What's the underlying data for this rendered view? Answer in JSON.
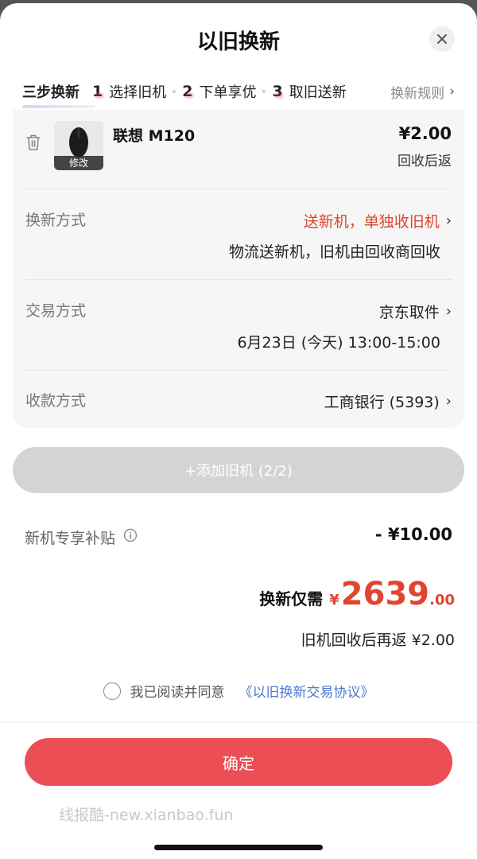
{
  "sheet": {
    "title": "以旧换新"
  },
  "steps": {
    "lead": "三步换新",
    "items": [
      {
        "num": "1",
        "label": "选择旧机"
      },
      {
        "num": "2",
        "label": "下单享优"
      },
      {
        "num": "3",
        "label": "取旧送新"
      }
    ],
    "rules_label": "换新规则"
  },
  "product": {
    "name": "联想 M120",
    "edit_label": "修改",
    "price": "¥2.00",
    "price_note": "回收后返"
  },
  "rows": [
    {
      "label": "换新方式",
      "value": "送新机，单独收旧机",
      "sub": "物流送新机，旧机由回收商回收"
    },
    {
      "label": "交易方式",
      "value": "京东取件",
      "sub": "6月23日 (今天) 13:00-15:00"
    },
    {
      "label": "收款方式",
      "value": "工商银行 (5393)"
    }
  ],
  "add_button": {
    "label": "+添加旧机 (2/2)"
  },
  "subsidy": {
    "label": "新机专享补贴",
    "value": "- ¥10.00"
  },
  "total": {
    "label": "换新仅需",
    "currency": "¥",
    "integer": "2639",
    "decimal": ".00",
    "return_note": "旧机回收后再返 ¥2.00"
  },
  "agreement": {
    "text": "我已阅读并同意",
    "link": "《以旧换新交易协议》"
  },
  "confirm": {
    "label": "确定"
  },
  "watermark": "线报酷-new.xianbao.fun",
  "colors": {
    "accent_red": "#e0452f",
    "button_red": "#eb4f55",
    "link_blue": "#4e78d6"
  }
}
